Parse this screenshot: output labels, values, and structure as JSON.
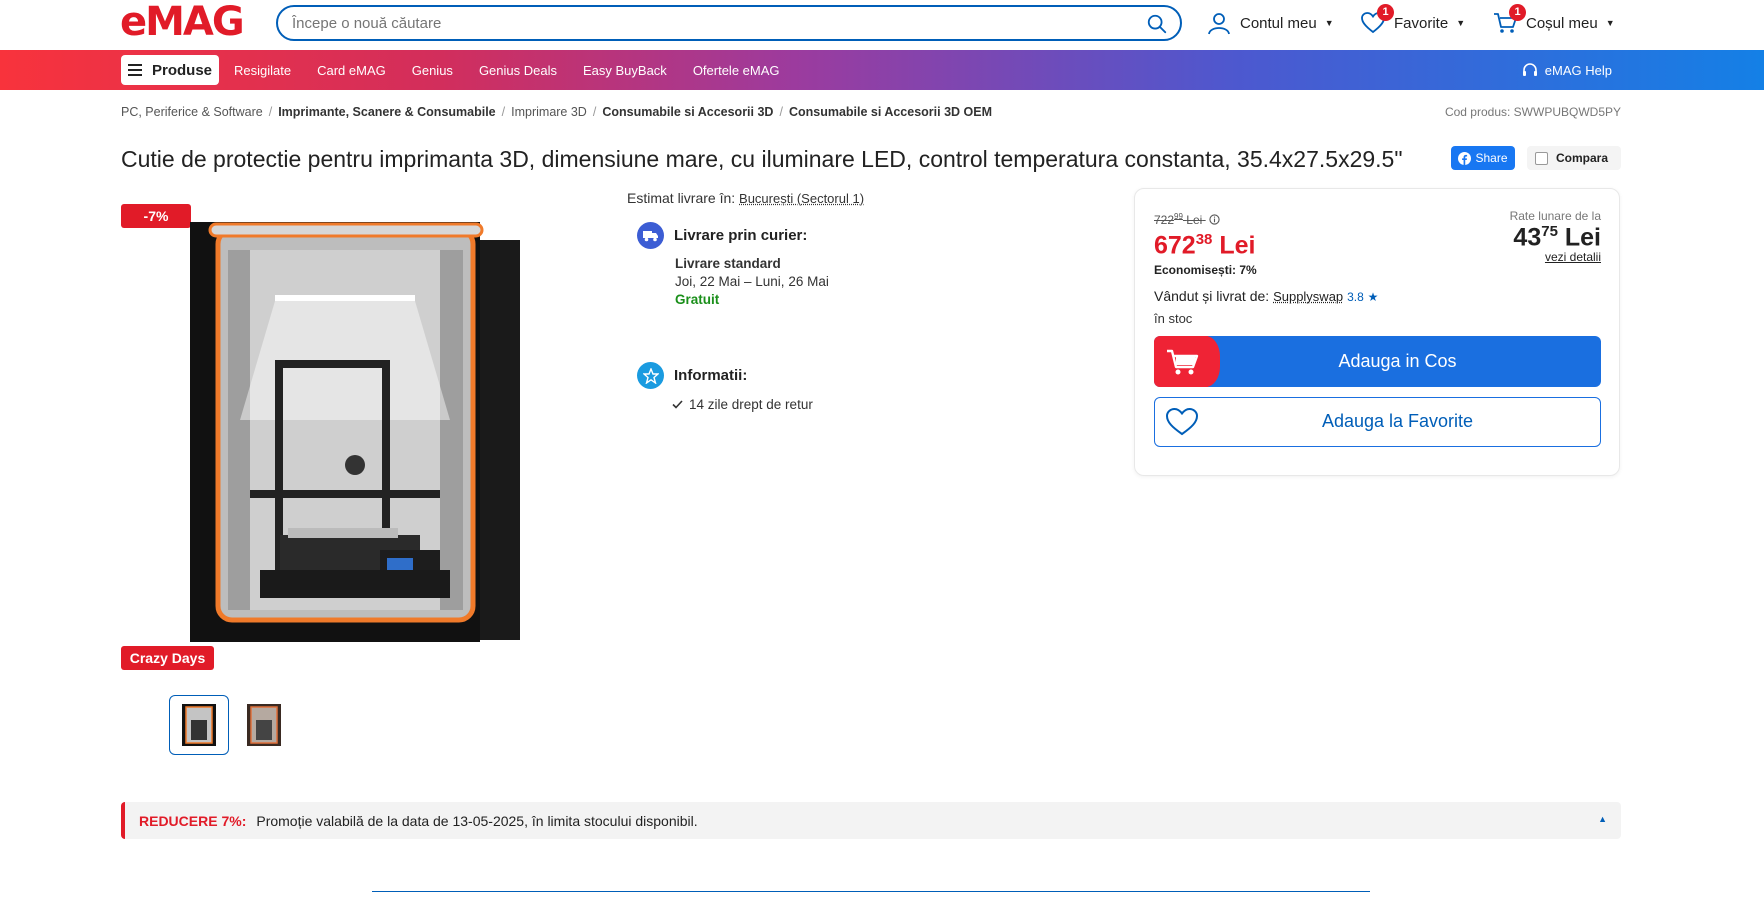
{
  "header": {
    "logo": "eMAG",
    "search_placeholder": "Începe o nouă căutare",
    "account_label": "Contul meu",
    "favorites_label": "Favorite",
    "favorites_count": "1",
    "cart_label": "Coșul meu",
    "cart_count": "1"
  },
  "nav": {
    "produse_label": "Produse",
    "links": [
      "Resigilate",
      "Card eMAG",
      "Genius",
      "Genius Deals",
      "Easy BuyBack",
      "Ofertele eMAG"
    ],
    "help_label": "eMAG Help"
  },
  "breadcrumb": {
    "items": [
      "PC, Periferice & Software",
      "Imprimante, Scanere & Consumabile",
      "Imprimare 3D",
      "Consumabile si Accesorii 3D",
      "Consumabile si Accesorii 3D OEM"
    ],
    "code": "Cod produs: SWWPUBQWD5PY"
  },
  "product": {
    "title": "Cutie de protectie pentru imprimanta 3D, dimensiune mare, cu iluminare LED, control temperatura constanta, 35.4x27.5x29.5\"",
    "share_label": "Share",
    "compare_label": "Compara",
    "discount_badge": "-7%",
    "campaign_badge": "Crazy Days"
  },
  "delivery": {
    "estimate_label": "Estimat livrare în:",
    "location": "București (Sectorul 1)",
    "courier_title": "Livrare prin curier:",
    "standard_label": "Livrare standard",
    "dates": "Joi, 22 Mai – Luni, 26 Mai",
    "cost": "Gratuit",
    "info_title": "Informatii:",
    "return_policy": "14 zile drept de retur"
  },
  "price": {
    "old_main": "722",
    "old_decimals": "99",
    "old_currency": "Lei",
    "new_main": "672",
    "new_decimals": "38",
    "new_currency": "Lei",
    "savings": "Economisești: 7%",
    "rate_label": "Rate lunare de la",
    "rate_main": "43",
    "rate_decimals": "75",
    "rate_currency": "Lei",
    "rate_details": "vezi detalii",
    "sold_by_label": "Vândut și livrat de:",
    "seller": "Supplyswap",
    "seller_rating": "3.8",
    "stock": "în stoc",
    "add_to_cart": "Adauga in Cos",
    "add_to_favorites": "Adauga la Favorite"
  },
  "promo": {
    "label": "REDUCERE 7%:",
    "text": "Promoție valabilă de la data de 13-05-2025, în limita stocului disponibil."
  },
  "colors": {
    "brand_red": "#e11b28",
    "brand_blue": "#005eb8",
    "success_green": "#1a8f1a"
  }
}
